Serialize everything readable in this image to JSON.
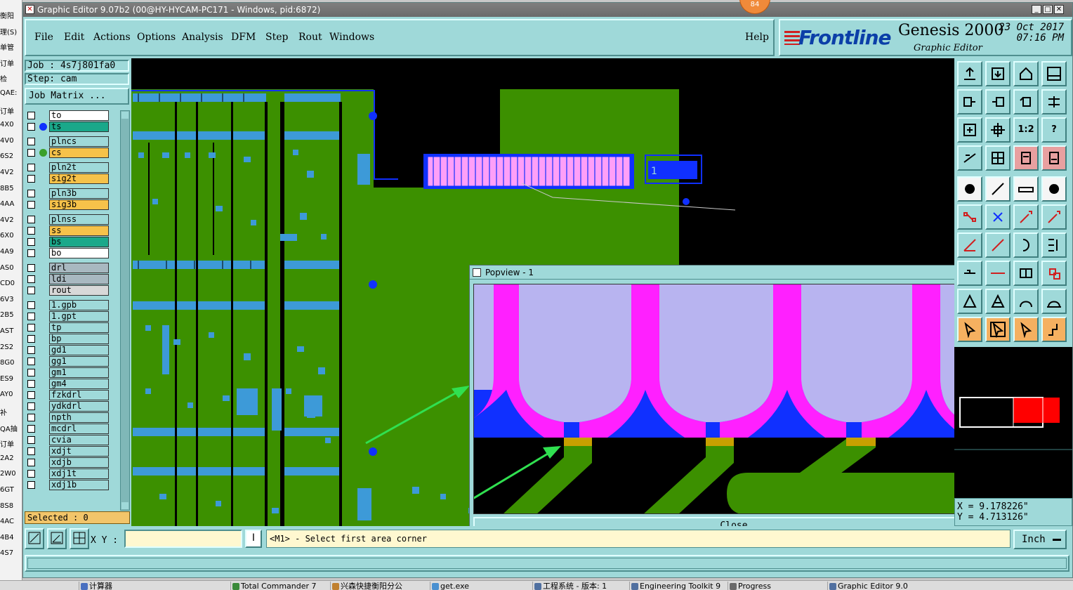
{
  "window": {
    "title": "Graphic Editor 9.07b2 (00@HY-HYCAM-PC171 - Windows, pid:6872)",
    "badge": "84"
  },
  "menu": [
    "File",
    "Edit",
    "Actions",
    "Options",
    "Analysis",
    "DFM",
    "Step",
    "Rout",
    "Windows"
  ],
  "help_label": "Help",
  "brand": {
    "logo": "Frontline",
    "product": "Genesis 2000",
    "subtitle": "Graphic Editor",
    "date": "23 Oct 2017",
    "time": "07:16 PM"
  },
  "job": {
    "job_label": "Job : 4s7j801fa0",
    "step_label": "Step: cam",
    "matrix_label": "Job Matrix ..."
  },
  "layers": [
    {
      "name": "to",
      "color": "#ffffff",
      "dot": ""
    },
    {
      "name": "ts",
      "color": "#1aa88a",
      "dot": "#1030ff"
    },
    {
      "name": "plncs",
      "color": "#9fd9d9",
      "dot": ""
    },
    {
      "name": "cs",
      "color": "#f6c24a",
      "dot": "#3aa02a"
    },
    {
      "name": "pln2t",
      "color": "#9fd9d9",
      "dot": ""
    },
    {
      "name": "sig2t",
      "color": "#f6c24a",
      "dot": ""
    },
    {
      "name": "pln3b",
      "color": "#9fd9d9",
      "dot": ""
    },
    {
      "name": "sig3b",
      "color": "#f6c24a",
      "dot": ""
    },
    {
      "name": "plnss",
      "color": "#9fd9d9",
      "dot": ""
    },
    {
      "name": "ss",
      "color": "#f6c24a",
      "dot": ""
    },
    {
      "name": "bs",
      "color": "#1aa88a",
      "dot": ""
    },
    {
      "name": "bo",
      "color": "#ffffff",
      "dot": ""
    },
    {
      "name": "drl",
      "color": "#a8b8c0",
      "dot": ""
    },
    {
      "name": "ldi",
      "color": "#a8b8c0",
      "dot": ""
    },
    {
      "name": "rout",
      "color": "#d8d8d8",
      "dot": ""
    },
    {
      "name": "1.gpb",
      "color": "#9fd9d9",
      "dot": ""
    },
    {
      "name": "1.gpt",
      "color": "#9fd9d9",
      "dot": ""
    },
    {
      "name": "tp",
      "color": "#9fd9d9",
      "dot": ""
    },
    {
      "name": "bp",
      "color": "#9fd9d9",
      "dot": ""
    },
    {
      "name": "gd1",
      "color": "#9fd9d9",
      "dot": ""
    },
    {
      "name": "gg1",
      "color": "#9fd9d9",
      "dot": ""
    },
    {
      "name": "gm1",
      "color": "#9fd9d9",
      "dot": ""
    },
    {
      "name": "gm4",
      "color": "#9fd9d9",
      "dot": ""
    },
    {
      "name": "fzkdrl",
      "color": "#9fd9d9",
      "dot": ""
    },
    {
      "name": "ydkdrl",
      "color": "#9fd9d9",
      "dot": ""
    },
    {
      "name": "npth",
      "color": "#9fd9d9",
      "dot": ""
    },
    {
      "name": "mcdrl",
      "color": "#9fd9d9",
      "dot": ""
    },
    {
      "name": "cvia",
      "color": "#9fd9d9",
      "dot": ""
    },
    {
      "name": "xdjt",
      "color": "#9fd9d9",
      "dot": ""
    },
    {
      "name": "xdjb",
      "color": "#9fd9d9",
      "dot": ""
    },
    {
      "name": "xdj1t",
      "color": "#9fd9d9",
      "dot": ""
    },
    {
      "name": "xdj1b",
      "color": "#9fd9d9",
      "dot": ""
    }
  ],
  "selected_label": "Selected : 0",
  "canvas": {
    "connector_label": "1"
  },
  "popview": {
    "title": "Popview - 1",
    "close_label": "Close",
    "close_x": "✕"
  },
  "toolbar_labels": {
    "ratio": "1:2",
    "help": "?"
  },
  "coords": {
    "x": "X = 9.178226\"",
    "y": "Y = 4.713126\""
  },
  "bottom": {
    "xy_label": "X Y :",
    "xy_value": "",
    "clear_label": "I",
    "prompt": "<M1> - Select first area corner",
    "unit": "Inch"
  },
  "bg_strip": [
    "衡阳",
    "理(S)",
    "单管",
    "订单",
    "检",
    "QAE:",
    "订单",
    "4X0",
    "4V0",
    "6S2",
    "4V2",
    "8B5",
    "4AA",
    "4V2",
    "6X0",
    "4A9",
    "AS0",
    "CD0",
    "6V3",
    "2B5",
    "AST",
    "2S2",
    "8G0",
    "ES9",
    "AY0",
    "补",
    "QA抽",
    "订单",
    "2A2",
    "2W0",
    "6GT",
    "8S8",
    "4AC",
    "4B4",
    "4S7"
  ],
  "taskbar": [
    "计算器",
    "Total Commander 7",
    "兴森快捷衡阳分公",
    "get.exe",
    "工程系统 - 版本: 1",
    "Engineering Toolkit 9",
    "Progress",
    "Graphic Editor 9.0"
  ],
  "colors": {
    "panel": "#9fd9d9",
    "copper_green": "#3c9000",
    "pad_blue": "#3d9ad8",
    "magenta": "#ff20ff",
    "lavender": "#b8b4f0",
    "deep_blue": "#1030ff"
  }
}
